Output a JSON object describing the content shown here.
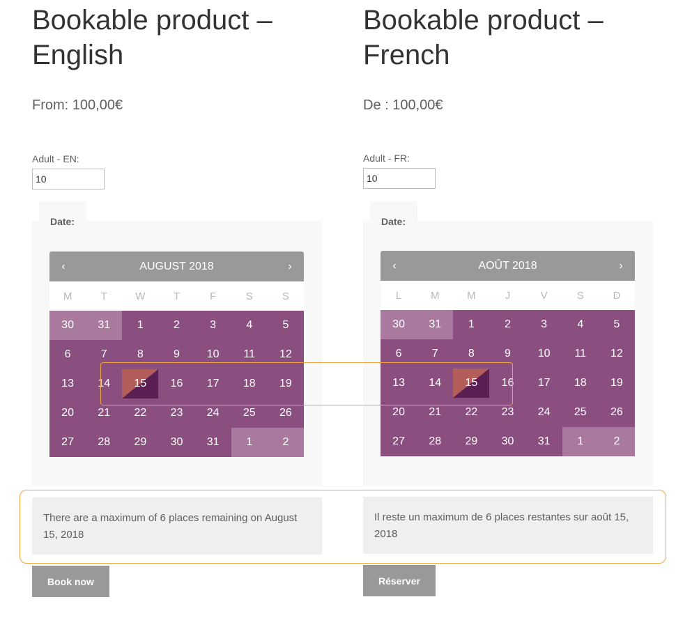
{
  "products": [
    {
      "title": "Bookable product – English",
      "price": "From: 100,00€",
      "adult_label": "Adult - EN:",
      "adult_value": "10",
      "date_label": "Date:",
      "calendar": {
        "month": "AUGUST 2018",
        "prev": "‹",
        "next": "›",
        "weekdays": [
          "M",
          "T",
          "W",
          "T",
          "F",
          "S",
          "S"
        ],
        "days": [
          "30",
          "31",
          "1",
          "2",
          "3",
          "4",
          "5",
          "6",
          "7",
          "8",
          "9",
          "10",
          "11",
          "12",
          "13",
          "14",
          "15",
          "16",
          "17",
          "18",
          "19",
          "20",
          "21",
          "22",
          "23",
          "24",
          "25",
          "26",
          "27",
          "28",
          "29",
          "30",
          "31",
          "1",
          "2"
        ]
      },
      "notice": "There are a maximum of 6 places remaining on August 15, 2018",
      "button": "Book now"
    },
    {
      "title": "Bookable product – French",
      "price": "De : 100,00€",
      "adult_label": "Adult - FR:",
      "adult_value": "10",
      "date_label": "Date:",
      "calendar": {
        "month": "AOÛT 2018",
        "prev": "‹",
        "next": "›",
        "weekdays": [
          "L",
          "M",
          "M",
          "J",
          "V",
          "S",
          "D"
        ],
        "days": [
          "30",
          "31",
          "1",
          "2",
          "3",
          "4",
          "5",
          "6",
          "7",
          "8",
          "9",
          "10",
          "11",
          "12",
          "13",
          "14",
          "15",
          "16",
          "17",
          "18",
          "19",
          "20",
          "21",
          "22",
          "23",
          "24",
          "25",
          "26",
          "27",
          "28",
          "29",
          "30",
          "31",
          "1",
          "2"
        ]
      },
      "notice": "Il reste un maximum de 6 places restantes sur août 15, 2018",
      "button": "Réserver"
    }
  ],
  "calendar_state": {
    "other_month_cells": [
      0,
      1,
      33,
      34
    ],
    "selected_cell": 16
  },
  "colors": {
    "day_bg": "#8a4f7e",
    "other_month_bg": "#a97a9e",
    "header_bg": "#999999",
    "highlight": "#f0a445"
  }
}
